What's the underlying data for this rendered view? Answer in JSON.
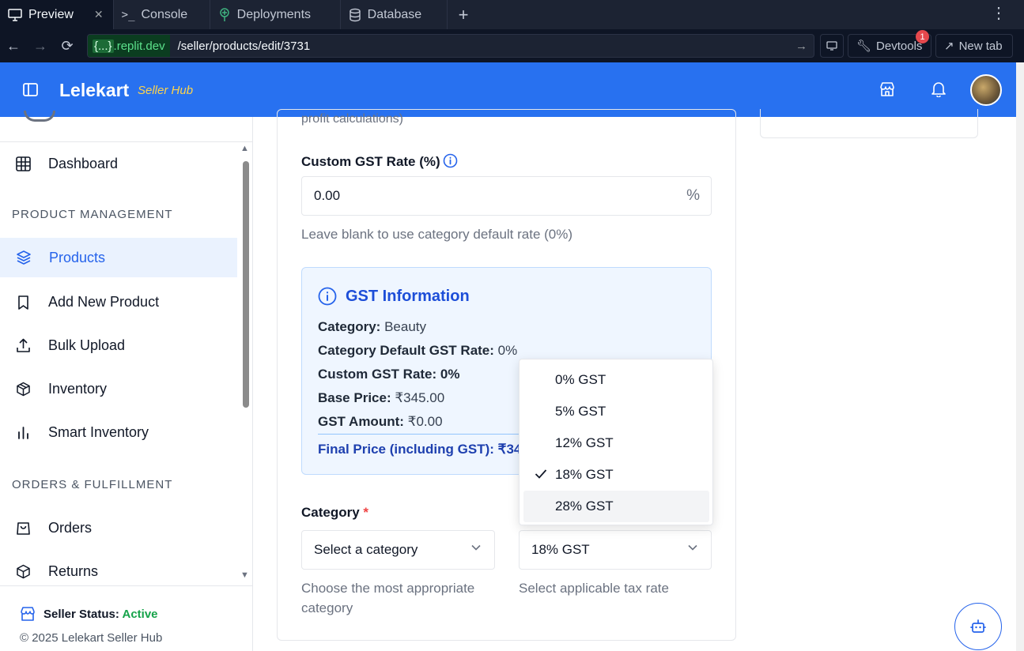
{
  "browser": {
    "tabs": [
      {
        "label": "Preview",
        "icon": "monitor-icon"
      },
      {
        "label": "Console",
        "icon": "terminal-icon"
      },
      {
        "label": "Deployments",
        "icon": "deploy-icon"
      },
      {
        "label": "Database",
        "icon": "database-icon"
      }
    ],
    "url_domain_prefix": "{...}",
    "url_domain": ".replit.dev",
    "url_path": "/seller/products/edit/3731",
    "devtools_label": "Devtools",
    "devtools_badge": "1",
    "newtab_label": "New tab"
  },
  "header": {
    "brand": "Lelekart",
    "brand_sub": "Seller Hub"
  },
  "sidebar": {
    "dashboard": "Dashboard",
    "section_product": "PRODUCT MANAGEMENT",
    "products": "Products",
    "add_new_product": "Add New Product",
    "bulk_upload": "Bulk Upload",
    "inventory": "Inventory",
    "smart_inventory": "Smart Inventory",
    "section_orders": "ORDERS & FULFILLMENT",
    "orders": "Orders",
    "returns": "Returns",
    "status_label": "Seller Status:",
    "status_value": "Active",
    "copyright": "© 2025 Lelekart Seller Hub"
  },
  "form": {
    "cut_text": "profit calculations)",
    "custom_gst_label": "Custom GST Rate (%)",
    "custom_gst_value": "0.00",
    "custom_gst_suffix": "%",
    "custom_gst_help": "Leave blank to use category default rate (0%)",
    "gst_info": {
      "title": "GST Information",
      "category_label": "Category:",
      "category_value": "Beauty",
      "default_rate_label": "Category Default GST Rate:",
      "default_rate_value": "0%",
      "custom_rate_label": "Custom GST Rate:",
      "custom_rate_value": "0%",
      "base_price_label": "Base Price:",
      "base_price_value": "₹345.00",
      "gst_amount_label": "GST Amount:",
      "gst_amount_value": "₹0.00",
      "final_price": "Final Price (including GST): ₹345"
    },
    "category_label": "Category",
    "required_mark": "*",
    "category_placeholder": "Select a category",
    "category_help": "Choose the most appropriate category",
    "tax_selected": "18% GST",
    "tax_help": "Select applicable tax rate"
  },
  "tax_dropdown": {
    "options": [
      "0% GST",
      "5% GST",
      "12% GST",
      "18% GST",
      "28% GST"
    ],
    "checked": "18% GST",
    "hovered": "28% GST"
  },
  "colors": {
    "header_bg": "#2871f0",
    "accent": "#2563eb",
    "active_status": "#16a34a"
  }
}
